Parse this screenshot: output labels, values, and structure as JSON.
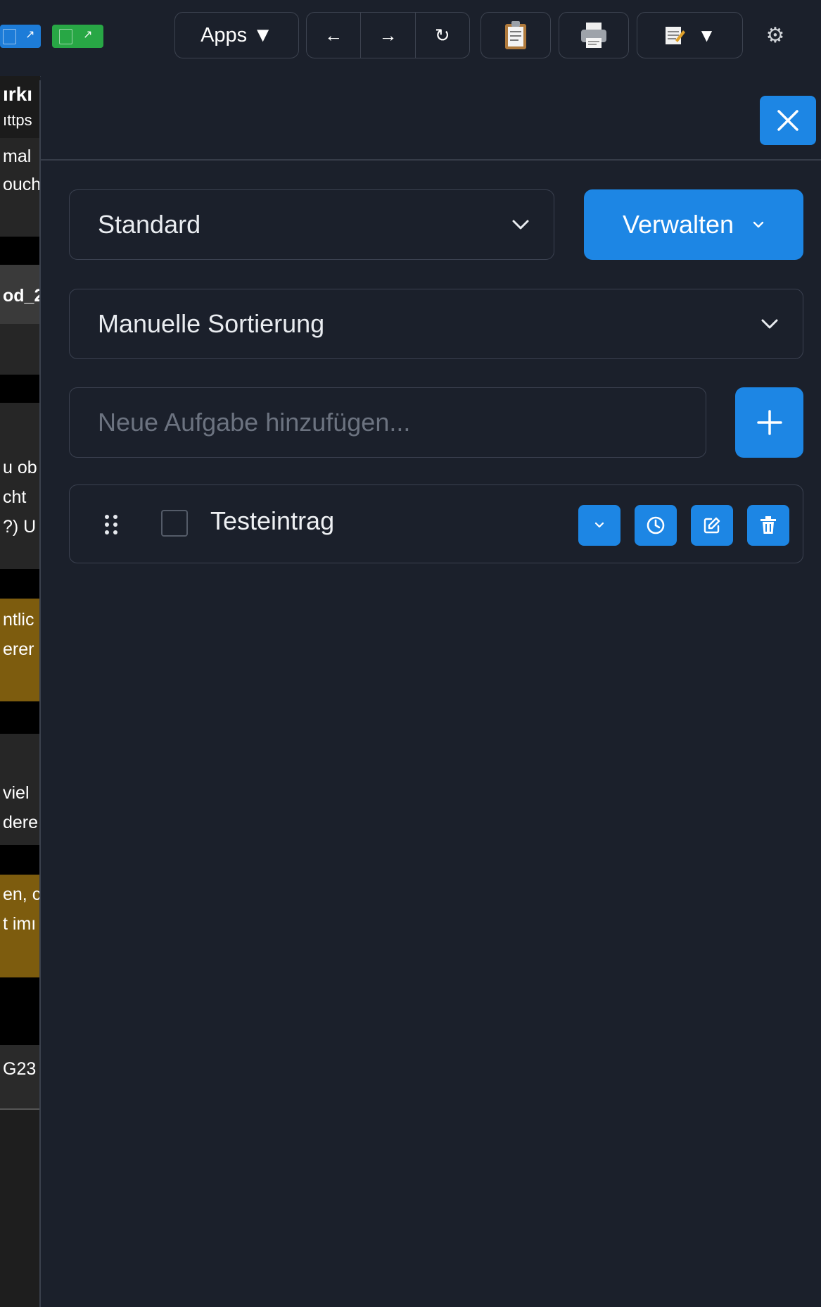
{
  "toolbar": {
    "apps_label": "Apps ▼",
    "back_label": "←",
    "forward_label": "→",
    "reload_label": "↻",
    "clipboard_icon": "clipboard-icon",
    "print_icon": "printer-icon",
    "notes_dropdown_icon": "notepad-icon",
    "settings_icon": "gear-icon"
  },
  "background": {
    "fragments": [
      "ırkı",
      "ıttps",
      "mal",
      "ouch",
      "od_2",
      "u ob",
      "cht",
      "?) U",
      "ntlic",
      "erer",
      "viel",
      "dere",
      "en, c",
      "t imı",
      "G23"
    ]
  },
  "panel": {
    "close_label": "✕",
    "list_select_value": "Standard",
    "manage_label": "Verwalten",
    "sort_select_value": "Manuelle Sortierung",
    "new_task_placeholder": "Neue Aufgabe hinzufügen...",
    "add_label": "+",
    "tasks": [
      {
        "label": "Testeintrag",
        "checked": false
      }
    ]
  },
  "colors": {
    "background": "#1b202b",
    "accent": "#1d86e4",
    "border": "#3b4150",
    "text": "#e9ecf0",
    "placeholder": "#6c7380",
    "highlight": "#7d5c0e"
  }
}
